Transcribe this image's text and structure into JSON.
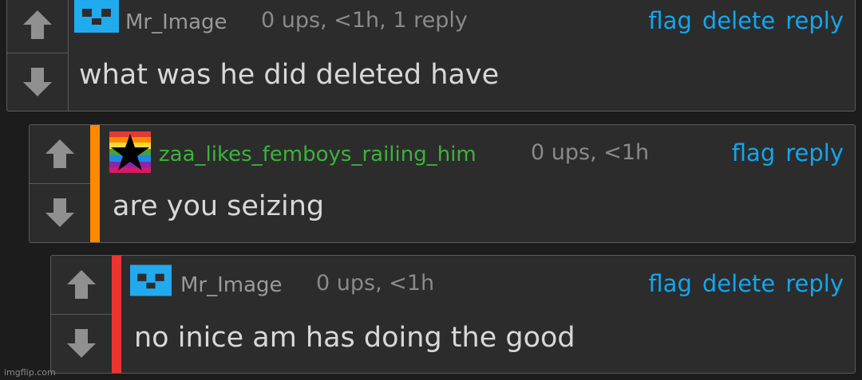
{
  "comments": [
    {
      "username": "Mr_Image",
      "meta": "0 ups, <1h, 1 reply",
      "actions": {
        "flag": "flag",
        "delete": "delete",
        "reply": "reply"
      },
      "body": "what was he did deleted have",
      "avatar_icon": "blue-pixel-face-icon"
    },
    {
      "username": "zaa_likes_femboys_railing_him",
      "meta": "0 ups, <1h",
      "actions": {
        "flag": "flag",
        "reply": "reply"
      },
      "body": "are you seizing",
      "avatar_icon": "rainbow-star-icon",
      "depth_color": "#ff8800",
      "username_color": "#3bb33b"
    },
    {
      "username": "Mr_Image",
      "meta": "0 ups, <1h",
      "actions": {
        "flag": "flag",
        "delete": "delete",
        "reply": "reply"
      },
      "body": "no inice am has doing the good",
      "avatar_icon": "blue-pixel-face-icon",
      "depth_color": "#ee3333"
    }
  ],
  "icons": {
    "upvote": "up-arrow-icon",
    "downvote": "down-arrow-icon"
  },
  "colors": {
    "link": "#12a6ee",
    "avatar_blue": "#22aaee"
  },
  "watermark": "imgflip.com"
}
